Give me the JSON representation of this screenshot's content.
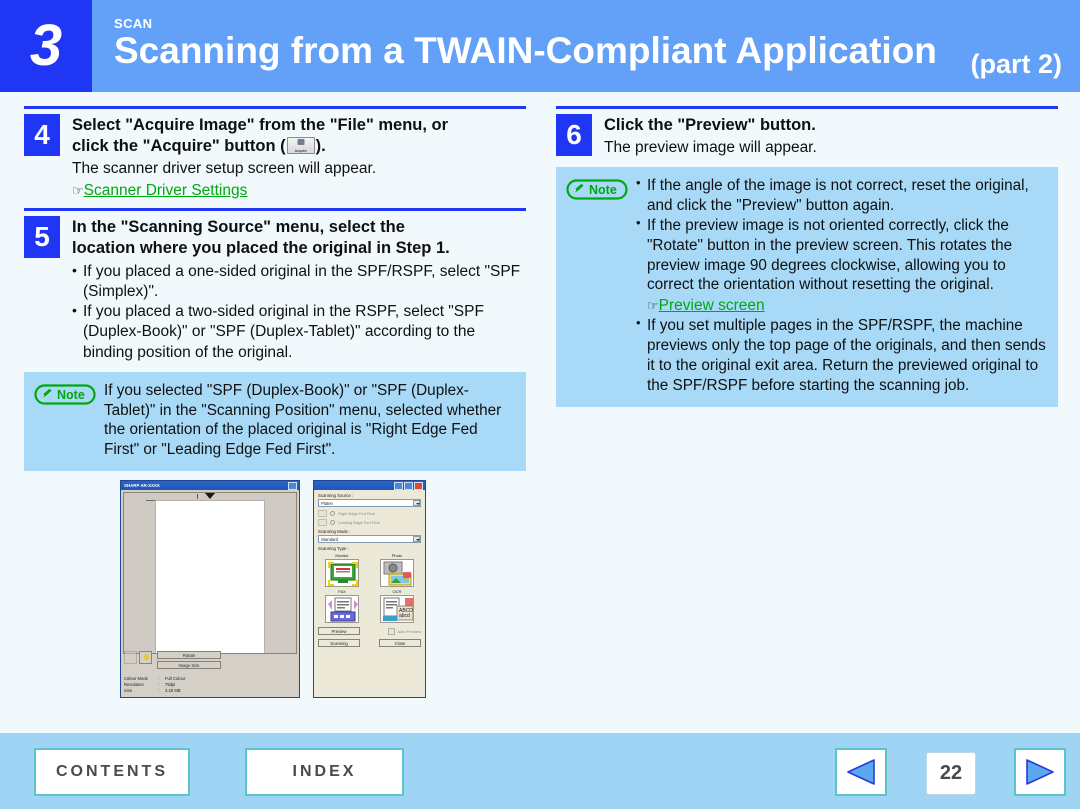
{
  "header": {
    "chapter_number": "3",
    "kicker": "SCAN",
    "title": "Scanning from a TWAIN-Compliant Application",
    "part": "(part 2)"
  },
  "left_column": {
    "step4": {
      "number": "4",
      "title_line1": "Select \"Acquire Image\" from the \"File\" menu, or",
      "title_line2_pre": "click the \"Acquire\" button (",
      "title_line2_post": ").",
      "acquire_icon_caption": "Acquire",
      "body": "The scanner driver setup screen will appear.",
      "xref_marker": "☞",
      "xref_link": "Scanner Driver Settings"
    },
    "step5": {
      "number": "5",
      "title_line1": "In the \"Scanning Source\" menu, select the",
      "title_line2": "location where you placed the original in Step 1.",
      "bullets": [
        "If you placed a one-sided original in the SPF/RSPF, select \"SPF (Simplex)\".",
        "If you placed a two-sided original in the RSPF, select \"SPF (Duplex-Book)\" or \"SPF (Duplex-Tablet)\" according to the binding position of the original."
      ]
    },
    "note": {
      "badge_label": "Note",
      "text": "If you selected \"SPF (Duplex-Book)\" or \"SPF (Duplex-Tablet)\" in the \"Scanning Position\" menu, selected whether the orientation of the placed original is \"Right Edge Fed First\" or \"Leading Edge Fed First\"."
    }
  },
  "right_column": {
    "step6": {
      "number": "6",
      "title": "Click the \"Preview\" button.",
      "body": "The preview image will appear."
    },
    "note": {
      "badge_label": "Note",
      "bullets_before_xref": [
        "If the angle of the image is not correct, reset the original, and click the \"Preview\" button again.",
        "If the preview image is not oriented correctly, click the \"Rotate\" button in the preview screen. This rotates the preview image 90 degrees clockwise, allowing you to correct the orientation without resetting the original."
      ],
      "xref_marker": "☞",
      "xref_link": "Preview screen",
      "bullets_after_xref": [
        "If you set multiple pages in the SPF/RSPF, the machine previews only the top page of the originals, and then sends it to the original exit area. Return the previewed original to the SPF/RSPF before starting the scanning job."
      ]
    }
  },
  "figures": {
    "preview_window": {
      "title": "SHARP AR-XXXX",
      "buttons": [
        "Rotate",
        "Image Size"
      ],
      "status": [
        {
          "label": "Colour Mode",
          "value": "Full Colour"
        },
        {
          "label": "Resolution",
          "value": "75dpi"
        },
        {
          "label": "Size",
          "value": "3.28 MB"
        }
      ]
    },
    "driver_window": {
      "scanning_source_label": "Scanning Source :",
      "scanning_source_value": "Platen",
      "radio_right_edge": "Right Edge Fed First",
      "radio_leading_edge": "Leading Edge Fed First",
      "scanning_mode_label": "Scanning Mode :",
      "scanning_mode_value": "Standard",
      "scanning_type_label": "Scanning Type :",
      "types": [
        "Monitor",
        "Photo",
        "FAX",
        "OCR"
      ],
      "preview_button": "Preview",
      "auto_preview_checkbox": "Auto Preview",
      "scanning_button": "Scanning",
      "close_button": "Close"
    }
  },
  "footer": {
    "contents_label": "CONTENTS",
    "index_label": "INDEX",
    "page_number": "22",
    "prev_icon": "left-triangle",
    "next_icon": "right-triangle"
  },
  "colors": {
    "header_band": "#63a0f7",
    "chapter_block": "#2036f5",
    "page_background": "#f2f9fc",
    "note_background": "#a8daf8",
    "note_badge_green": "#00a80f",
    "link_green": "#00a80f",
    "footer_band": "#9fd4f5",
    "footer_button_border": "#5fc3c8"
  }
}
